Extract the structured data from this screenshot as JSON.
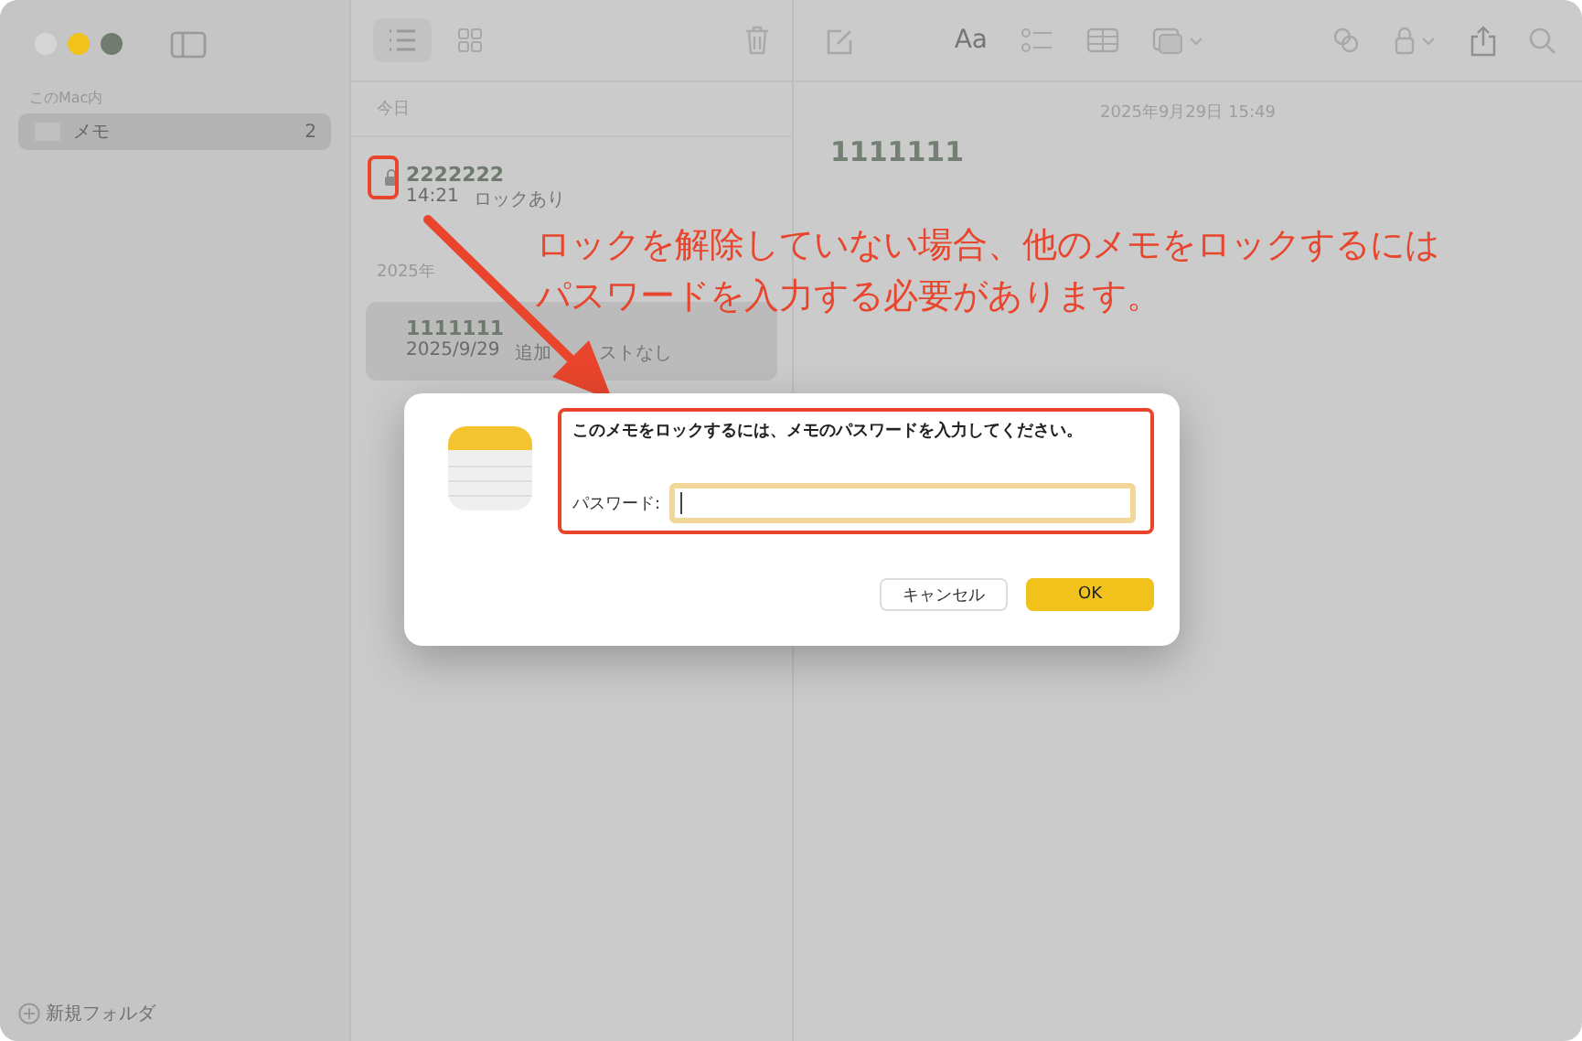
{
  "sidebar": {
    "section": "このMac内",
    "folders": [
      {
        "name": "メモ",
        "count": "2",
        "selected": true
      }
    ],
    "new_folder": "新規フォルダ"
  },
  "note_list": {
    "groups": [
      {
        "heading": "今日",
        "notes": [
          {
            "title": "2222222",
            "time": "14:21",
            "preview": "ロックあり",
            "locked": true,
            "selected": false
          }
        ]
      },
      {
        "heading": "2025年",
        "notes": [
          {
            "title": "1111111",
            "time": "2025/9/29",
            "preview": [
              "追加",
              "ストなし"
            ],
            "locked": false,
            "selected": true
          }
        ]
      }
    ]
  },
  "editor": {
    "format_button": "Aa",
    "date": "2025年9月29日 15:49",
    "title": "1111111"
  },
  "dialog": {
    "message": "このメモをロックするには、メモのパスワードを入力してください。",
    "field_label": "パスワード:",
    "buttons": [
      {
        "label": "キャンセル",
        "kind": "secondary"
      },
      {
        "label": "OK",
        "kind": "primary"
      }
    ]
  },
  "annotation": {
    "lines": [
      "ロックを解除していない場合、他のメモをロックするには",
      "パスワードを入力する必要があります。"
    ]
  }
}
